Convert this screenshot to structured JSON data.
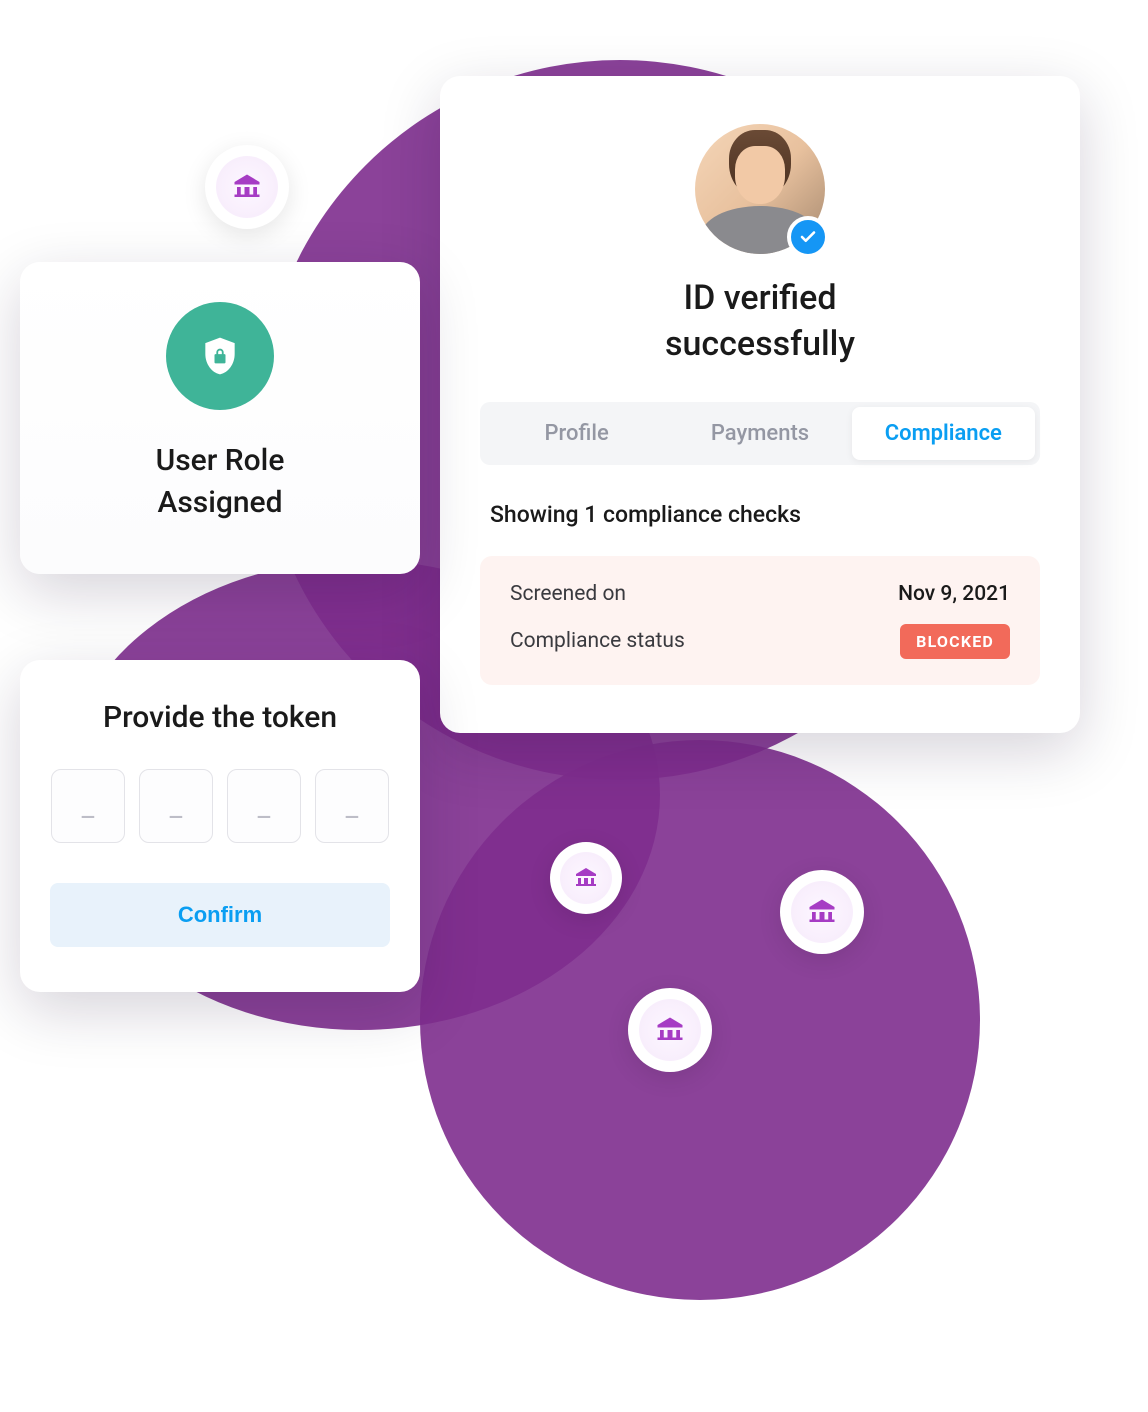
{
  "roleCard": {
    "title_line1": "User Role",
    "title_line2": "Assigned"
  },
  "tokenCard": {
    "title": "Provide the token",
    "placeholder": "_",
    "confirm_label": "Confirm"
  },
  "verifyCard": {
    "title_line1": "ID verified",
    "title_line2": "successfully",
    "tabs": {
      "profile": "Profile",
      "payments": "Payments",
      "compliance": "Compliance"
    },
    "list_title": "Showing 1 compliance checks",
    "compliance": {
      "screened_label": "Screened on",
      "screened_value": "Nov 9, 2021",
      "status_label": "Compliance status",
      "status_value": "BLOCKED"
    }
  }
}
